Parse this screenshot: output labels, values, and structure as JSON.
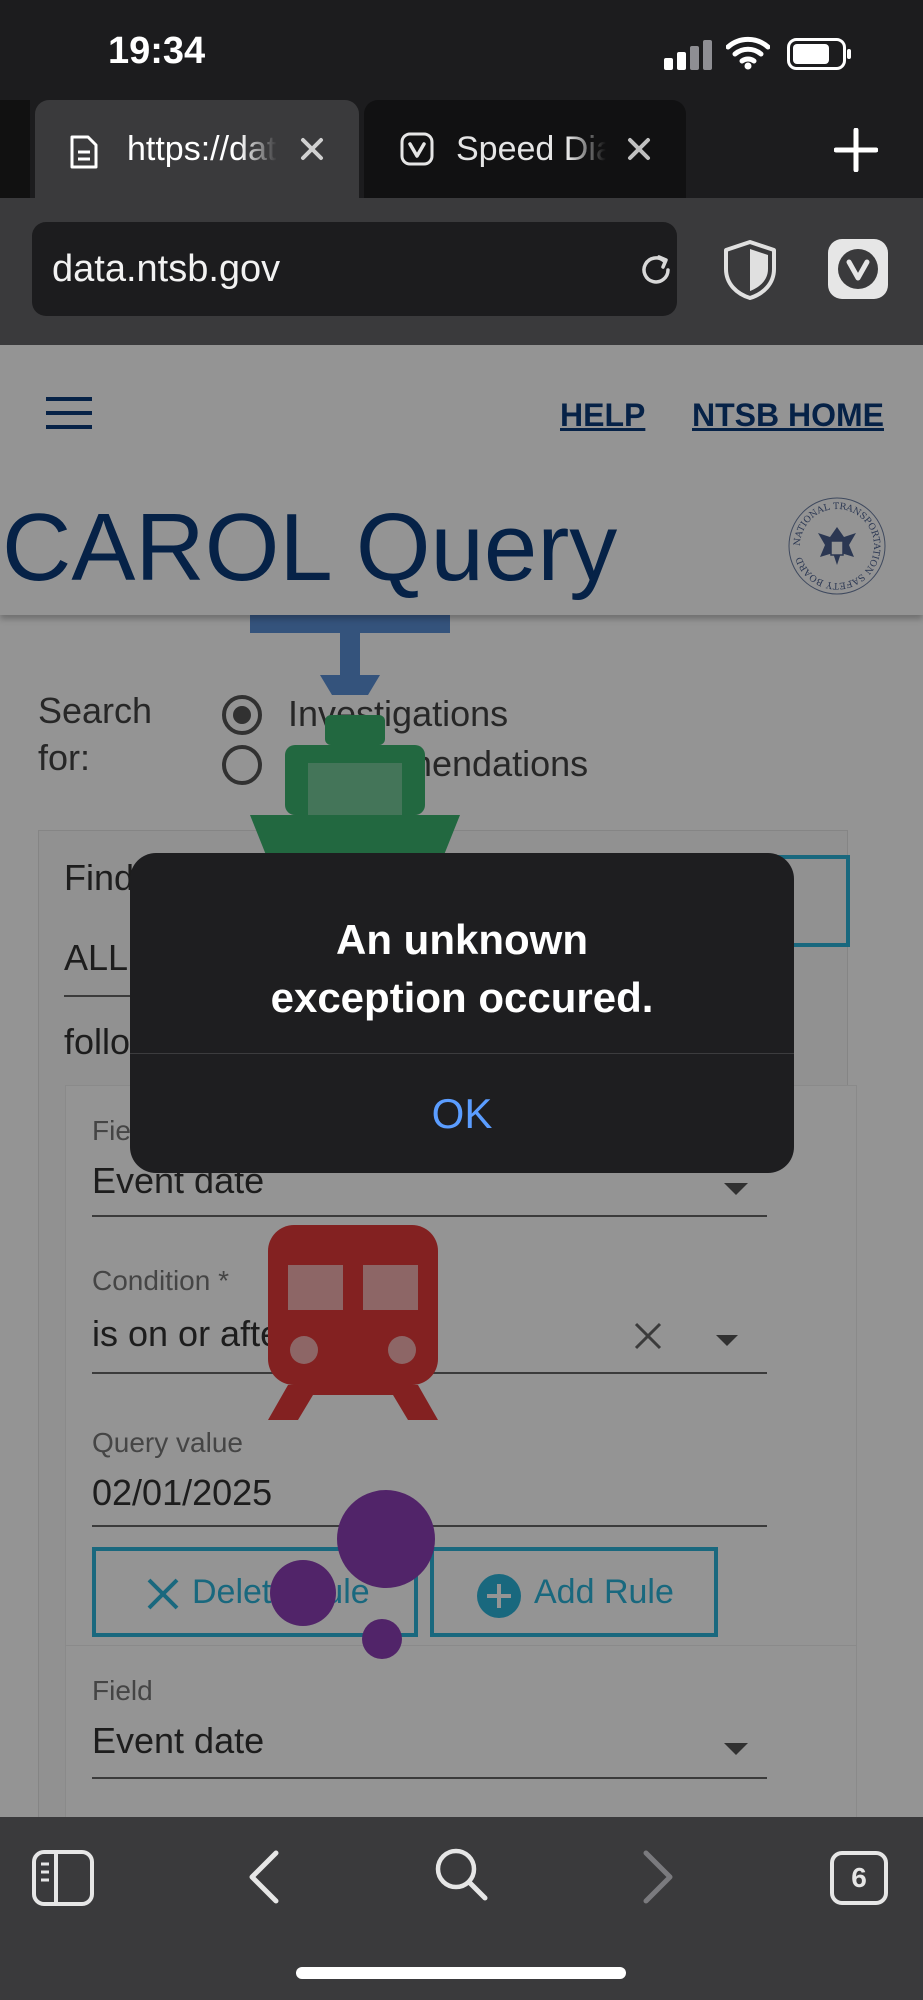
{
  "status_bar": {
    "time": "19:34"
  },
  "tabs": [
    {
      "label": "https://data.ntsb.gov",
      "icon": "document-icon"
    },
    {
      "label": "Speed Dial",
      "icon": "vivaldi-icon"
    }
  ],
  "address_bar": {
    "url": "data.ntsb.gov"
  },
  "page": {
    "nav": {
      "help": "HELP",
      "home": "NTSB HOME"
    },
    "title": "CAROL Query",
    "seal_text": "NATIONAL TRANSPORTATION SAFETY BOARD",
    "search_for": {
      "label_line1": "Search",
      "label_line2": "for:",
      "options": [
        "Investigations",
        "Recommendations"
      ],
      "selected": "Investigations"
    },
    "find": {
      "label": "Find",
      "match": "ALL",
      "following": "follo"
    },
    "rule1": {
      "field_label": "Fie",
      "field_value": "Event date",
      "condition_label": "Condition *",
      "condition_value": "is on or after",
      "query_label": "Query value",
      "query_value": "02/01/2025",
      "delete_label": "Delete Rule",
      "add_label": "Add Rule"
    },
    "rule2": {
      "field_label": "Field",
      "field_value": "Event date"
    }
  },
  "alert": {
    "line1": "An unknown",
    "line2": "exception occured.",
    "ok": "OK"
  },
  "toolbar": {
    "tab_count": "6"
  },
  "colors": {
    "brand": "#0c3b7a",
    "accent": "#2bb3d9",
    "alert_button": "#5b9dff"
  }
}
